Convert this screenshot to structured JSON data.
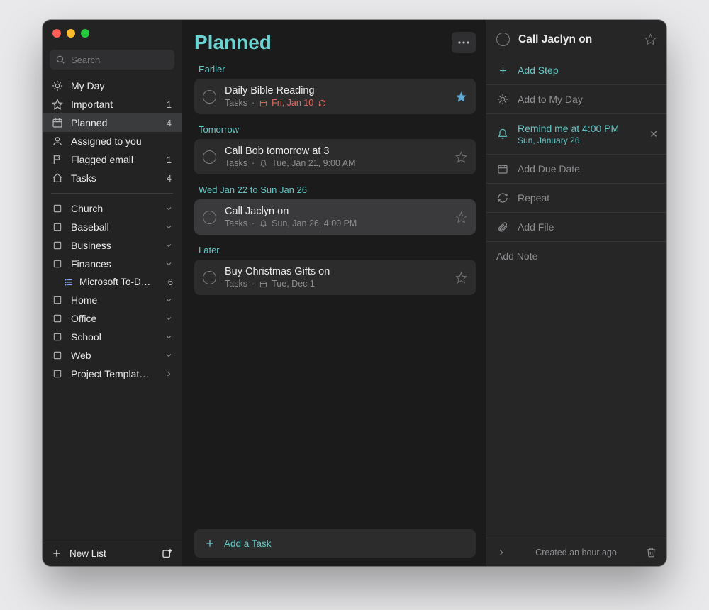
{
  "search": {
    "placeholder": "Search"
  },
  "sidebar": {
    "smart": [
      {
        "label": "My Day",
        "icon": "sun",
        "count": ""
      },
      {
        "label": "Important",
        "icon": "star",
        "count": "1"
      },
      {
        "label": "Planned",
        "icon": "calendar",
        "count": "4",
        "selected": true
      },
      {
        "label": "Assigned to you",
        "icon": "person",
        "count": ""
      },
      {
        "label": "Flagged email",
        "icon": "flag",
        "count": "1"
      },
      {
        "label": "Tasks",
        "icon": "home",
        "count": "4"
      }
    ],
    "groups": [
      {
        "label": "Church"
      },
      {
        "label": "Baseball"
      },
      {
        "label": "Business"
      },
      {
        "label": "Finances",
        "expanded": true,
        "children": [
          {
            "label": "Microsoft To-D…",
            "count": "6"
          }
        ]
      },
      {
        "label": "Home"
      },
      {
        "label": "Office"
      },
      {
        "label": "School"
      },
      {
        "label": "Web"
      },
      {
        "label": "Project Templat…",
        "chevron": "right"
      }
    ],
    "footer": {
      "new_list": "New List"
    }
  },
  "main": {
    "title": "Planned",
    "sections": [
      {
        "label": "Earlier",
        "tasks": [
          {
            "title": "Daily Bible Reading",
            "list": "Tasks",
            "due": "Fri, Jan 10",
            "due_color": "red",
            "due_icon": "calendar",
            "repeat": true,
            "star": "fill"
          }
        ]
      },
      {
        "label": "Tomorrow",
        "tasks": [
          {
            "title": "Call Bob tomorrow at 3",
            "list": "Tasks",
            "due": "Tue, Jan 21, 9:00 AM",
            "due_icon": "bell",
            "star": "empty"
          }
        ]
      },
      {
        "label": "Wed Jan 22 to Sun Jan 26",
        "tasks": [
          {
            "title": "Call Jaclyn on",
            "list": "Tasks",
            "due": "Sun, Jan 26, 4:00 PM",
            "due_icon": "bell",
            "star": "empty",
            "selected": true
          }
        ]
      },
      {
        "label": "Later",
        "tasks": [
          {
            "title": "Buy Christmas Gifts on",
            "list": "Tasks",
            "due": "Tue, Dec 1",
            "due_icon": "calendar",
            "star": "empty"
          }
        ]
      }
    ],
    "add_task": "Add a Task"
  },
  "detail": {
    "title": "Call Jaclyn on",
    "add_step": "Add Step",
    "add_my_day": "Add to My Day",
    "reminder": {
      "label": "Remind me at 4:00 PM",
      "sub": "Sun, January 26"
    },
    "add_due": "Add Due Date",
    "repeat": "Repeat",
    "add_file": "Add File",
    "add_note": "Add Note",
    "footer": {
      "created": "Created an hour ago"
    }
  }
}
